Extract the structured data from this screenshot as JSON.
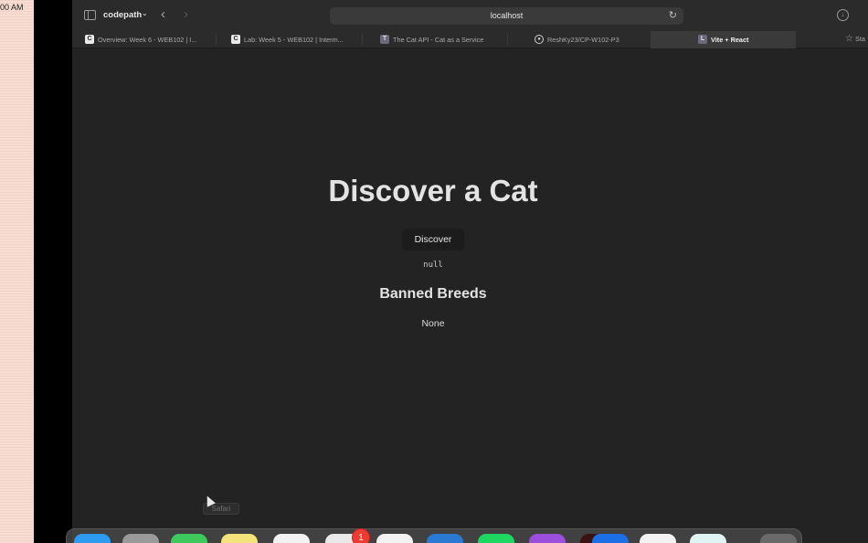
{
  "desktop": {
    "clock": "00 AM"
  },
  "browser": {
    "profile": "codepath",
    "url": "localhost",
    "tabs": [
      {
        "label": "Overview: Week 6 - WEB102 | I...",
        "favicon": "C"
      },
      {
        "label": "Lab: Week 5 - WEB102 | Interm...",
        "favicon": "C"
      },
      {
        "label": "The Cat API - Cat as a Service",
        "favicon": "T"
      },
      {
        "label": "ReshKy23/CP-W102-P3",
        "favicon": "github"
      },
      {
        "label": "Vite + React",
        "favicon": "L",
        "active": true
      }
    ],
    "extra_tab": "Sta"
  },
  "page": {
    "title": "Discover a Cat",
    "discover_button": "Discover",
    "result": "null",
    "banned_heading": "Banned Breeds",
    "banned_list": "None"
  },
  "tooltip": "Safari",
  "dock": {
    "apps": [
      "finder",
      "launchpad",
      "messages",
      "notes",
      "safari",
      "chatgpt",
      "docs",
      "vscode",
      "spotify",
      "podcasts",
      "terminal",
      "app-store",
      "slack",
      "copilot",
      "trash"
    ],
    "badge": "1",
    "colors": [
      "#2d9cf0",
      "#9a9a9a",
      "#3dc95b",
      "#f4e27a",
      "#f3f3f3",
      "#e9e9e9",
      "#f3f3f3",
      "#2a7ad4",
      "#1ed760",
      "#9b4fdc",
      "#3a1212",
      "#1d6fe6",
      "#f3f3f3",
      "#e0f4f4",
      "#6a6a6a"
    ]
  }
}
